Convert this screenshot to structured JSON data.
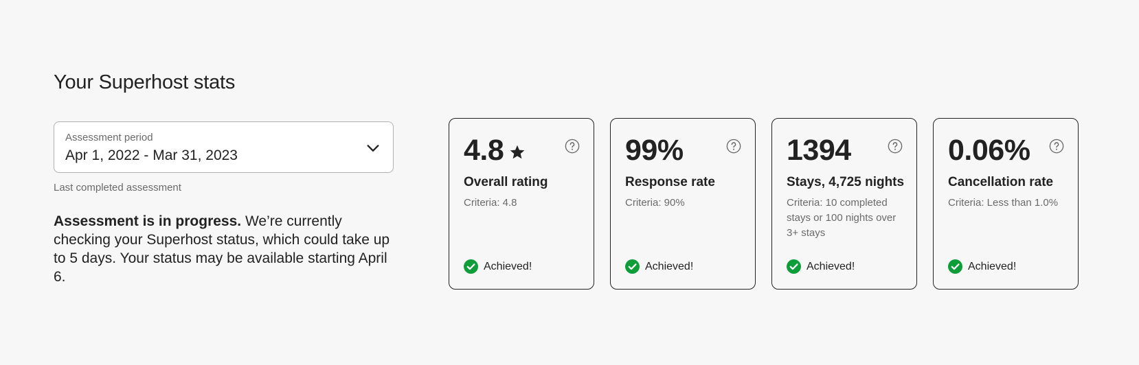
{
  "page": {
    "title": "Your Superhost stats"
  },
  "assessment": {
    "label": "Assessment period",
    "value": "Apr 1, 2022 - Mar 31, 2023",
    "caption": "Last completed assessment",
    "dropdown_icon": "chevron-down-icon"
  },
  "progress": {
    "bold": "Assessment is in progress.",
    "text": " We’re currently checking your Superhost status, which could take up to 5 days. Your status may be available starting April 6."
  },
  "cards": [
    {
      "value": "4.8",
      "title": "Overall rating",
      "criteria": "Criteria: 4.8",
      "status": "Achieved!",
      "icon": "star-icon"
    },
    {
      "value": "99%",
      "title": "Response rate",
      "criteria": "Criteria: 90%",
      "status": "Achieved!"
    },
    {
      "value": "1394",
      "title": "Stays, 4,725 nights",
      "criteria": "Criteria: 10 completed stays or 100 nights over 3+ stays",
      "status": "Achieved!"
    },
    {
      "value": "0.06%",
      "title": "Cancellation rate",
      "criteria": "Criteria: Less than 1.0%",
      "status": "Achieved!"
    }
  ],
  "colors": {
    "background": "#f7f7f7",
    "text": "#222222",
    "secondary_text": "#6a6a6a",
    "success": "#0f9d3a",
    "border": "#b0b0b0"
  }
}
